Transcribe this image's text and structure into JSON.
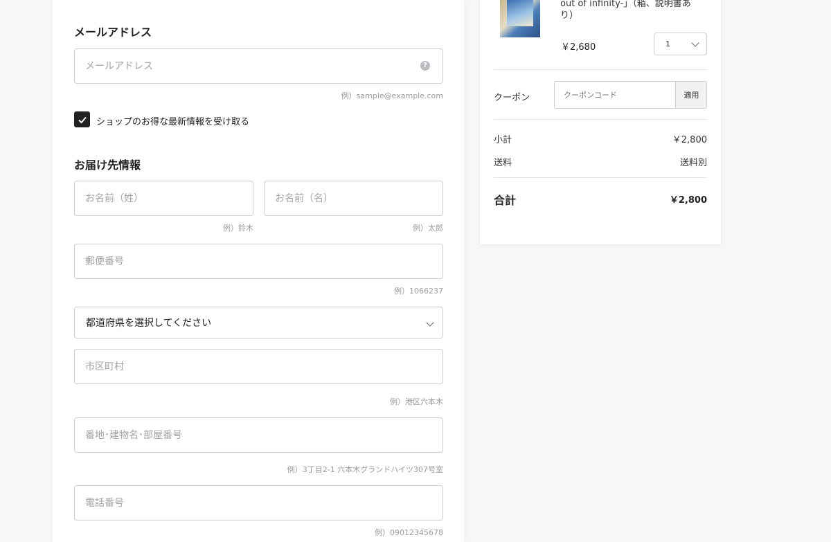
{
  "email_section": {
    "title": "メールアドレス",
    "email_placeholder": "メールアドレス",
    "email_value": "",
    "help_icon": "question-circle-icon",
    "email_hint": "例）sample@example.com",
    "newsletter_label": "ショップのお得な最新情報を受け取る",
    "newsletter_checked": true
  },
  "shipping_section": {
    "title": "お届け先情報",
    "last_name_placeholder": "お名前（姓）",
    "last_name_hint": "例）鈴木",
    "first_name_placeholder": "お名前（名）",
    "first_name_hint": "例）太郎",
    "postal_placeholder": "郵便番号",
    "postal_hint": "例）1066237",
    "prefecture_selected": "都道府県を選択してください",
    "city_placeholder": "市区町村",
    "city_hint": "例）港区六本木",
    "address_placeholder": "番地･建物名･部屋番号",
    "address_hint": "例）3丁目2-1 六本木グランドハイツ307号室",
    "phone_placeholder": "電話番号",
    "phone_hint": "例）09012345678"
  },
  "order_summary": {
    "item": {
      "title_line1": "out of infinity-」（箱、説明書あ",
      "title_line2": "り）",
      "price": "￥2,680",
      "quantity": "1"
    },
    "coupon": {
      "label": "クーポン",
      "placeholder": "クーポンコード",
      "apply_label": "適用"
    },
    "subtotal_label": "小計",
    "subtotal_value": "￥2,800",
    "shipping_label": "送料",
    "shipping_value": "送料別",
    "total_label": "合計",
    "total_value": "￥2,800"
  }
}
